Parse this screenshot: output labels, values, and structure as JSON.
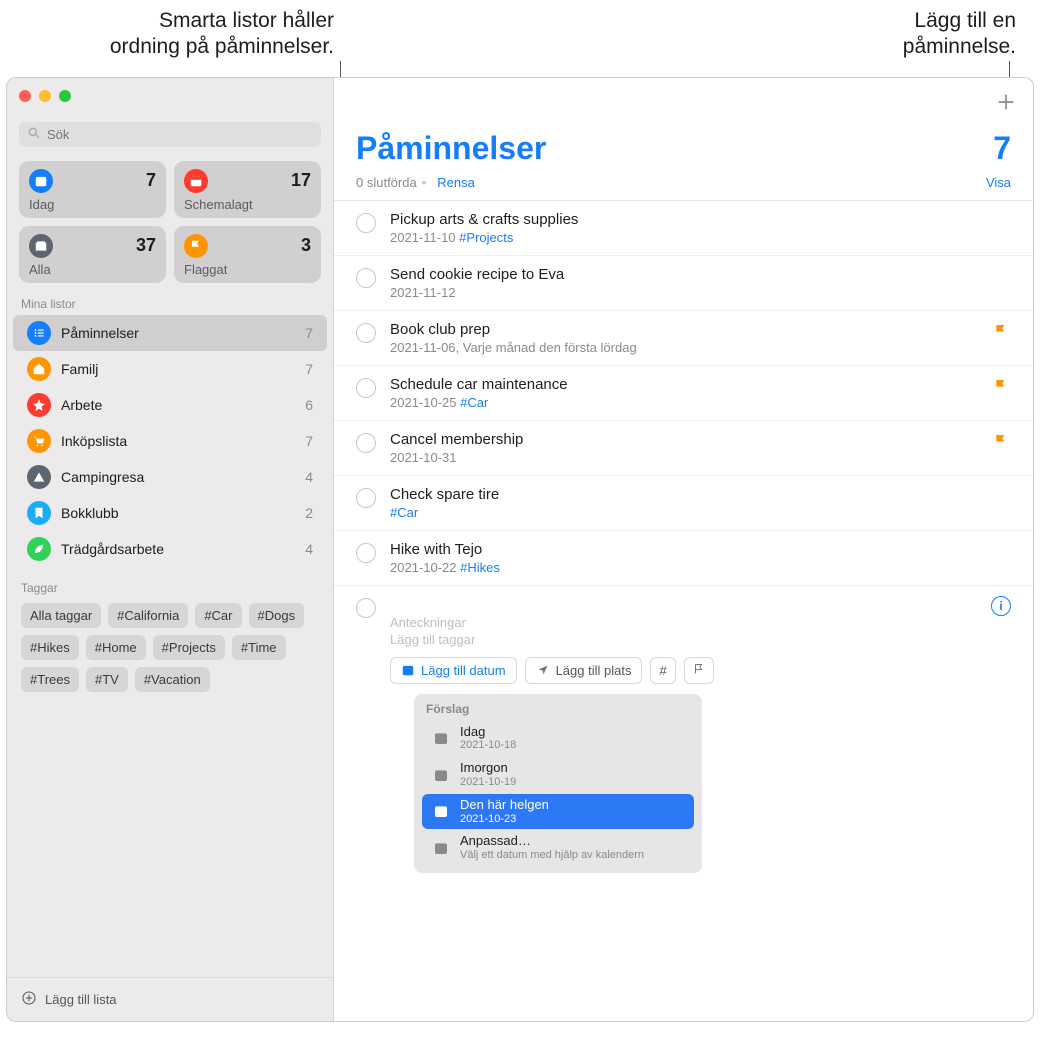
{
  "callouts": {
    "left_l1": "Smarta listor håller",
    "left_l2": "ordning på påminnelser.",
    "right_l1": "Lägg till en",
    "right_l2": "påminnelse."
  },
  "search": {
    "placeholder": "Sök"
  },
  "smart_cards": {
    "today": {
      "label": "Idag",
      "count": "7",
      "color": "#147efb"
    },
    "scheduled": {
      "label": "Schemalagt",
      "count": "17",
      "color": "#ff3b30"
    },
    "all": {
      "label": "Alla",
      "count": "37",
      "color": "#5b6670"
    },
    "flagged": {
      "label": "Flaggat",
      "count": "3",
      "color": "#ff9500"
    }
  },
  "sidebar": {
    "lists_header": "Mina listor",
    "lists": [
      {
        "name": "Påminnelser",
        "count": "7",
        "color": "#147efb",
        "icon": "list"
      },
      {
        "name": "Familj",
        "count": "7",
        "color": "#ff9500",
        "icon": "home"
      },
      {
        "name": "Arbete",
        "count": "6",
        "color": "#ff3b30",
        "icon": "star"
      },
      {
        "name": "Inköpslista",
        "count": "7",
        "color": "#ff9500",
        "icon": "cart"
      },
      {
        "name": "Campingresa",
        "count": "4",
        "color": "#5b6670",
        "icon": "tent"
      },
      {
        "name": "Bokklubb",
        "count": "2",
        "color": "#1badf8",
        "icon": "bookmark"
      },
      {
        "name": "Trädgårdsarbete",
        "count": "4",
        "color": "#30d158",
        "icon": "leaf"
      }
    ],
    "tags_header": "Taggar",
    "tags": [
      "Alla taggar",
      "#California",
      "#Car",
      "#Dogs",
      "#Hikes",
      "#Home",
      "#Projects",
      "#Time",
      "#Trees",
      "#TV",
      "#Vacation"
    ],
    "add_list": "Lägg till lista"
  },
  "main": {
    "title": "Påminnelser",
    "count": "7",
    "completed_text": "0 slutförda",
    "clear": "Rensa",
    "show": "Visa"
  },
  "reminders": [
    {
      "title": "Pickup arts & crafts supplies",
      "meta": "2021-11-10",
      "tag": "#Projects",
      "flag": false
    },
    {
      "title": "Send cookie recipe to Eva",
      "meta": "2021-11-12",
      "tag": "",
      "flag": false
    },
    {
      "title": "Book club prep",
      "meta": "2021-11-06, Varje månad den första lördag",
      "tag": "",
      "flag": true
    },
    {
      "title": "Schedule car maintenance",
      "meta": "2021-10-25",
      "tag": "#Car",
      "flag": true
    },
    {
      "title": "Cancel membership",
      "meta": "2021-10-31",
      "tag": "",
      "flag": true
    },
    {
      "title": "Check spare tire",
      "meta": "",
      "tag": "#Car",
      "flag": false
    },
    {
      "title": "Hike with Tejo",
      "meta": "2021-10-22",
      "tag": "#Hikes",
      "flag": false
    }
  ],
  "new_reminder": {
    "notes_placeholder": "Anteckningar",
    "tags_placeholder": "Lägg till taggar",
    "add_date": "Lägg till datum",
    "add_location": "Lägg till plats"
  },
  "suggestions": {
    "header": "Förslag",
    "items": [
      {
        "t1": "Idag",
        "t2": "2021-10-18",
        "selected": false
      },
      {
        "t1": "Imorgon",
        "t2": "2021-10-19",
        "selected": false
      },
      {
        "t1": "Den här helgen",
        "t2": "2021-10-23",
        "selected": true
      },
      {
        "t1": "Anpassad…",
        "t2": "Välj ett datum med hjälp av kalendern",
        "selected": false
      }
    ]
  }
}
